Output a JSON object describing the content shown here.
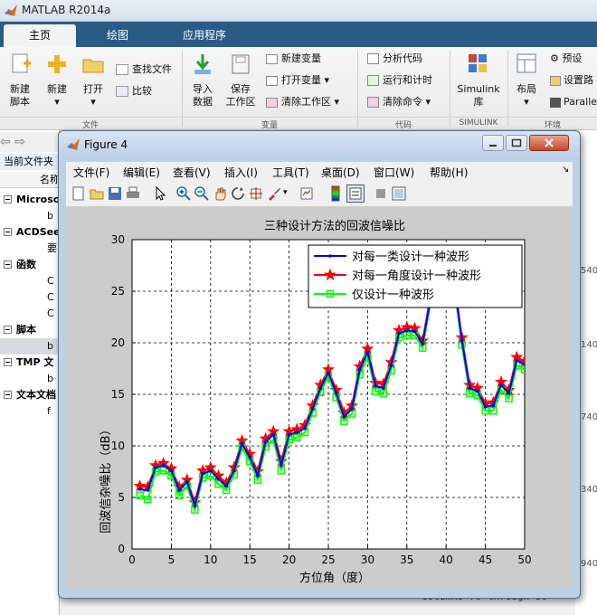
{
  "app": {
    "title": "MATLAB R2014a"
  },
  "tabs": [
    "主页",
    "绘图",
    "应用程序"
  ],
  "ribbon": {
    "new_script": "新建\n脚本",
    "new": "新建",
    "open": "打开",
    "find_files": "查找文件",
    "compare": "比较",
    "import_data": "导入\n数据",
    "save_workspace": "保存\n工作区",
    "new_variable": "新建变量",
    "open_variable": "打开变量",
    "clear_workspace": "清除工作区",
    "analyze_code": "分析代码",
    "run_and_time": "运行和计时",
    "clear_commands": "清除命令",
    "simulink": "Simulink\n库",
    "layout": "布局",
    "preferences": "预设",
    "set_path": "设置路",
    "parallel": "Paralle",
    "groups": [
      "文件",
      "变量",
      "代码",
      "SIMULINK",
      "环境"
    ]
  },
  "left_panel": {
    "header": "当前文件夹",
    "col": "名称",
    "rows": [
      "Microso",
      "b",
      "ACDSee",
      "要",
      "函数",
      "C",
      "C",
      "C",
      "脚本",
      "b",
      "TMP 文",
      "b",
      "文本文档",
      "f"
    ]
  },
  "right_numbers": [
    "540",
    "140",
    "740",
    "340",
    "940"
  ],
  "command_tail": "Columns 76 through 90",
  "figure": {
    "title": "Figure 4",
    "menu": [
      "文件(F)",
      "编辑(E)",
      "查看(V)",
      "插入(I)",
      "工具(T)",
      "桌面(D)",
      "窗口(W)",
      "帮助(H)"
    ]
  },
  "chart_data": {
    "type": "line",
    "title": "三种设计方法的回波信噪比",
    "xlabel": "方位角（度）",
    "ylabel": "回波信杂噪比（dB）",
    "xlim": [
      0,
      50
    ],
    "ylim": [
      0,
      30
    ],
    "xticks": [
      0,
      5,
      10,
      15,
      20,
      25,
      30,
      35,
      40,
      45,
      50
    ],
    "yticks": [
      0,
      5,
      10,
      15,
      20,
      25,
      30
    ],
    "grid": true,
    "legend_position": "top-right",
    "x": [
      1,
      2,
      3,
      4,
      5,
      6,
      7,
      8,
      9,
      10,
      11,
      12,
      13,
      14,
      15,
      16,
      17,
      18,
      19,
      20,
      21,
      22,
      23,
      24,
      25,
      26,
      27,
      28,
      29,
      30,
      31,
      32,
      33,
      34,
      35,
      36,
      37,
      38,
      39,
      40,
      41,
      42,
      43,
      44,
      45,
      46,
      47,
      48,
      49,
      50
    ],
    "series": [
      {
        "name": "对每一类设计一种波形",
        "color": "#0000ff",
        "marker": "dot",
        "values": [
          5.8,
          5.7,
          7.9,
          8.1,
          7.6,
          5.7,
          6.5,
          4.2,
          7.3,
          7.6,
          6.8,
          6.1,
          7.6,
          10.2,
          8.9,
          7.1,
          10.4,
          11.1,
          8.1,
          11.1,
          11.3,
          11.7,
          13.6,
          15.6,
          17.1,
          15.1,
          12.8,
          13.6,
          17.4,
          19.1,
          15.8,
          15.6,
          17.8,
          20.9,
          21.2,
          21.1,
          19.9,
          24.2,
          26,
          26.8,
          26,
          20.2,
          15.6,
          15.3,
          13.8,
          13.9,
          15.9,
          15.1,
          18.3,
          17.9
        ]
      },
      {
        "name": "对每一角度设计一种波形",
        "color": "#ff0000",
        "marker": "star",
        "values": [
          6.1,
          6,
          8.1,
          8.3,
          7.8,
          6,
          6.7,
          4.5,
          7.6,
          7.9,
          7.1,
          6.4,
          7.9,
          10.5,
          9.2,
          7.5,
          10.7,
          11.4,
          8.5,
          11.4,
          11.6,
          12,
          13.9,
          15.9,
          17.4,
          15.4,
          13.2,
          13.9,
          17.7,
          19.4,
          16.1,
          16,
          18.1,
          21.2,
          21.5,
          21.4,
          20.2,
          24.5,
          26.3,
          27.1,
          26.3,
          20.5,
          15.9,
          15.6,
          14.1,
          14.2,
          16.2,
          15.4,
          18.6,
          18.2
        ]
      },
      {
        "name": "仅设计一种波形",
        "color": "#00ff00",
        "marker": "square",
        "values": [
          5.2,
          4.8,
          7.5,
          7.6,
          7.1,
          5.2,
          6.1,
          3.8,
          6.9,
          7.1,
          6.3,
          5.7,
          7.2,
          9.8,
          8.5,
          6.7,
          9.9,
          10.6,
          7.6,
          10.6,
          10.8,
          11.3,
          13.2,
          15.2,
          16.7,
          14.7,
          12.4,
          13.1,
          16.9,
          18.6,
          15.3,
          15.1,
          17.3,
          20.5,
          20.7,
          20.7,
          19.5,
          23.8,
          25.6,
          26.4,
          25.6,
          19.8,
          15.1,
          14.9,
          13.4,
          13.4,
          15.4,
          14.6,
          17.8,
          17.4
        ]
      }
    ]
  }
}
